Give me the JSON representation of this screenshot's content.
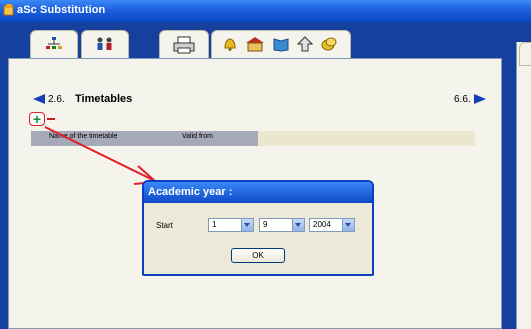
{
  "window": {
    "title": "aSc Substitution"
  },
  "toolbar": {
    "tabs": [
      {
        "icon": "org-chart-icon"
      },
      {
        "icon": "people-icon"
      },
      {
        "icon": "printer-icon"
      },
      {
        "icon": "bell-icon"
      },
      {
        "icon": "school-building-icon"
      },
      {
        "icon": "book-icon"
      },
      {
        "icon": "up-arrow-icon"
      },
      {
        "icon": "coins-icon"
      }
    ]
  },
  "navigation": {
    "prev_label": "2.6.",
    "next_label": "6.6."
  },
  "page": {
    "title": "Timetables"
  },
  "table": {
    "columns": [
      "Name of the timetable",
      "Valid from"
    ]
  },
  "dialog": {
    "title": "Academic year :",
    "start_label": "Start",
    "day": "1",
    "month": "9",
    "year": "2004",
    "ok_label": "OK"
  },
  "colors": {
    "titlebar": "#0b48c6",
    "accent_red": "#e0202a",
    "add_green": "#1a8a2a"
  }
}
